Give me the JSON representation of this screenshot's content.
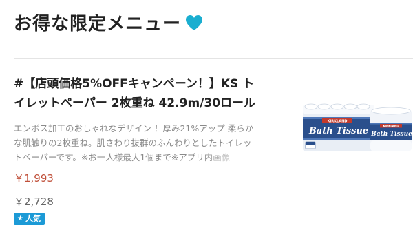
{
  "section": {
    "title": "お得な限定メニュー",
    "heart_color": "#1aaed0"
  },
  "product": {
    "title": "#【店頭価格5%OFFキャンペーン！】KS トイレットペーパー 2枚重ね 42.9m/30ロール",
    "description": "エンボス加工のおしゃれなデザイン ！厚み21%アップ 柔らかな肌触りの2枚重ね。肌さわり抜群のふんわりとしたトイレットペーパーです。※お一人様最大1個まで※アプリ内画像",
    "price_sale": "￥1,993",
    "price_original": "￥2,728",
    "badge_label": "人気",
    "badge_icon": "star-icon",
    "image_icon": "toilet-paper-package-icon",
    "package_brand": "KIRKLAND",
    "package_name": "Bath Tissue",
    "accent_color": "#1c9ad6",
    "sale_color": "#c0503a"
  }
}
